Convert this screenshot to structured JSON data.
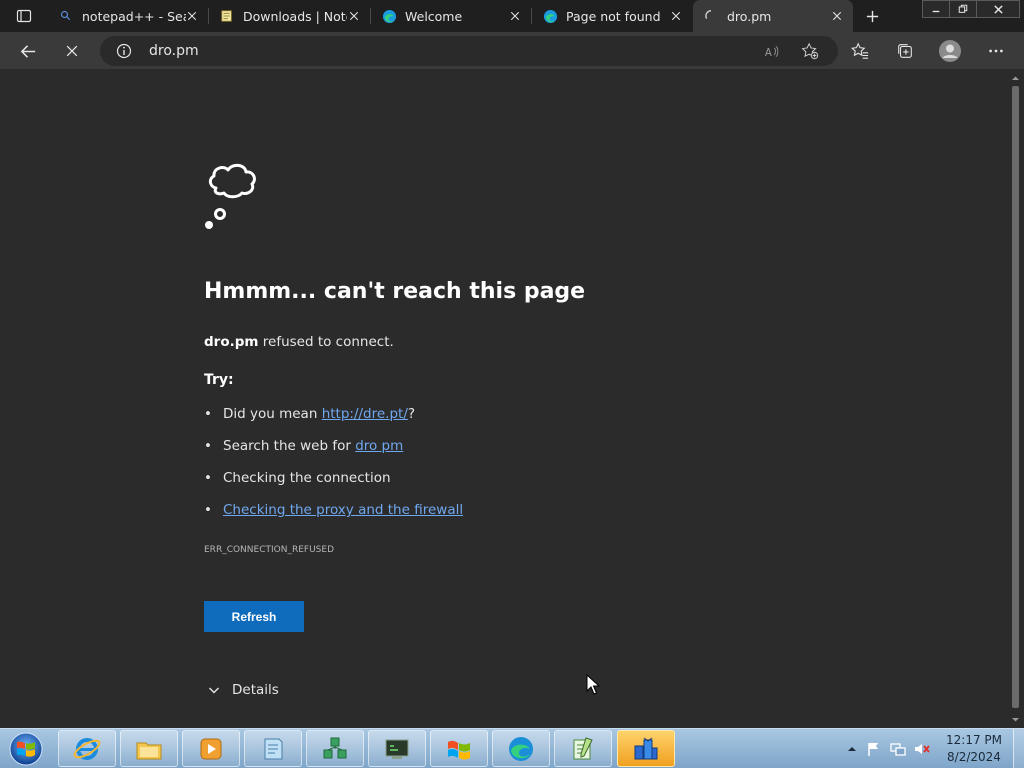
{
  "browser": {
    "tabs": [
      {
        "title": "notepad++ - Search",
        "favicon": "search-icon",
        "active": false
      },
      {
        "title": "Downloads | Notepad++",
        "favicon": "notepad-icon",
        "active": false
      },
      {
        "title": "Welcome",
        "favicon": "edge-icon",
        "active": false
      },
      {
        "title": "Page not found",
        "favicon": "edge-icon",
        "active": false
      },
      {
        "title": "dro.pm",
        "favicon": "loading-spinner-icon",
        "active": true
      }
    ],
    "address_bar": {
      "url": "dro.pm"
    }
  },
  "error_page": {
    "title": "Hmmm... can't reach this page",
    "host": "dro.pm",
    "message": " refused to connect.",
    "try_label": "Try:",
    "suggestions": {
      "mean_prefix": "Did you mean ",
      "mean_link": "http://dre.pt/",
      "mean_suffix": "?",
      "search_prefix": "Search the web for ",
      "search_link": "dro pm",
      "connection": "Checking the connection",
      "proxy_link": "Checking the proxy and the firewall"
    },
    "error_code": "ERR_CONNECTION_REFUSED",
    "refresh_label": "Refresh",
    "details_label": "Details"
  },
  "taskbar": {
    "clock_time": "12:17 PM",
    "clock_date": "8/2/2024",
    "apps": [
      "internet-explorer-icon",
      "file-explorer-icon",
      "media-player-icon",
      "notepad-icon",
      "network-icon",
      "terminal-icon",
      "windows-logo-icon",
      "edge-icon",
      "notepadpp-icon",
      "installer-icon"
    ]
  },
  "colors": {
    "accent": "#0f6cbd",
    "link": "#70a8f0",
    "page_bg": "#2b2b2b"
  }
}
